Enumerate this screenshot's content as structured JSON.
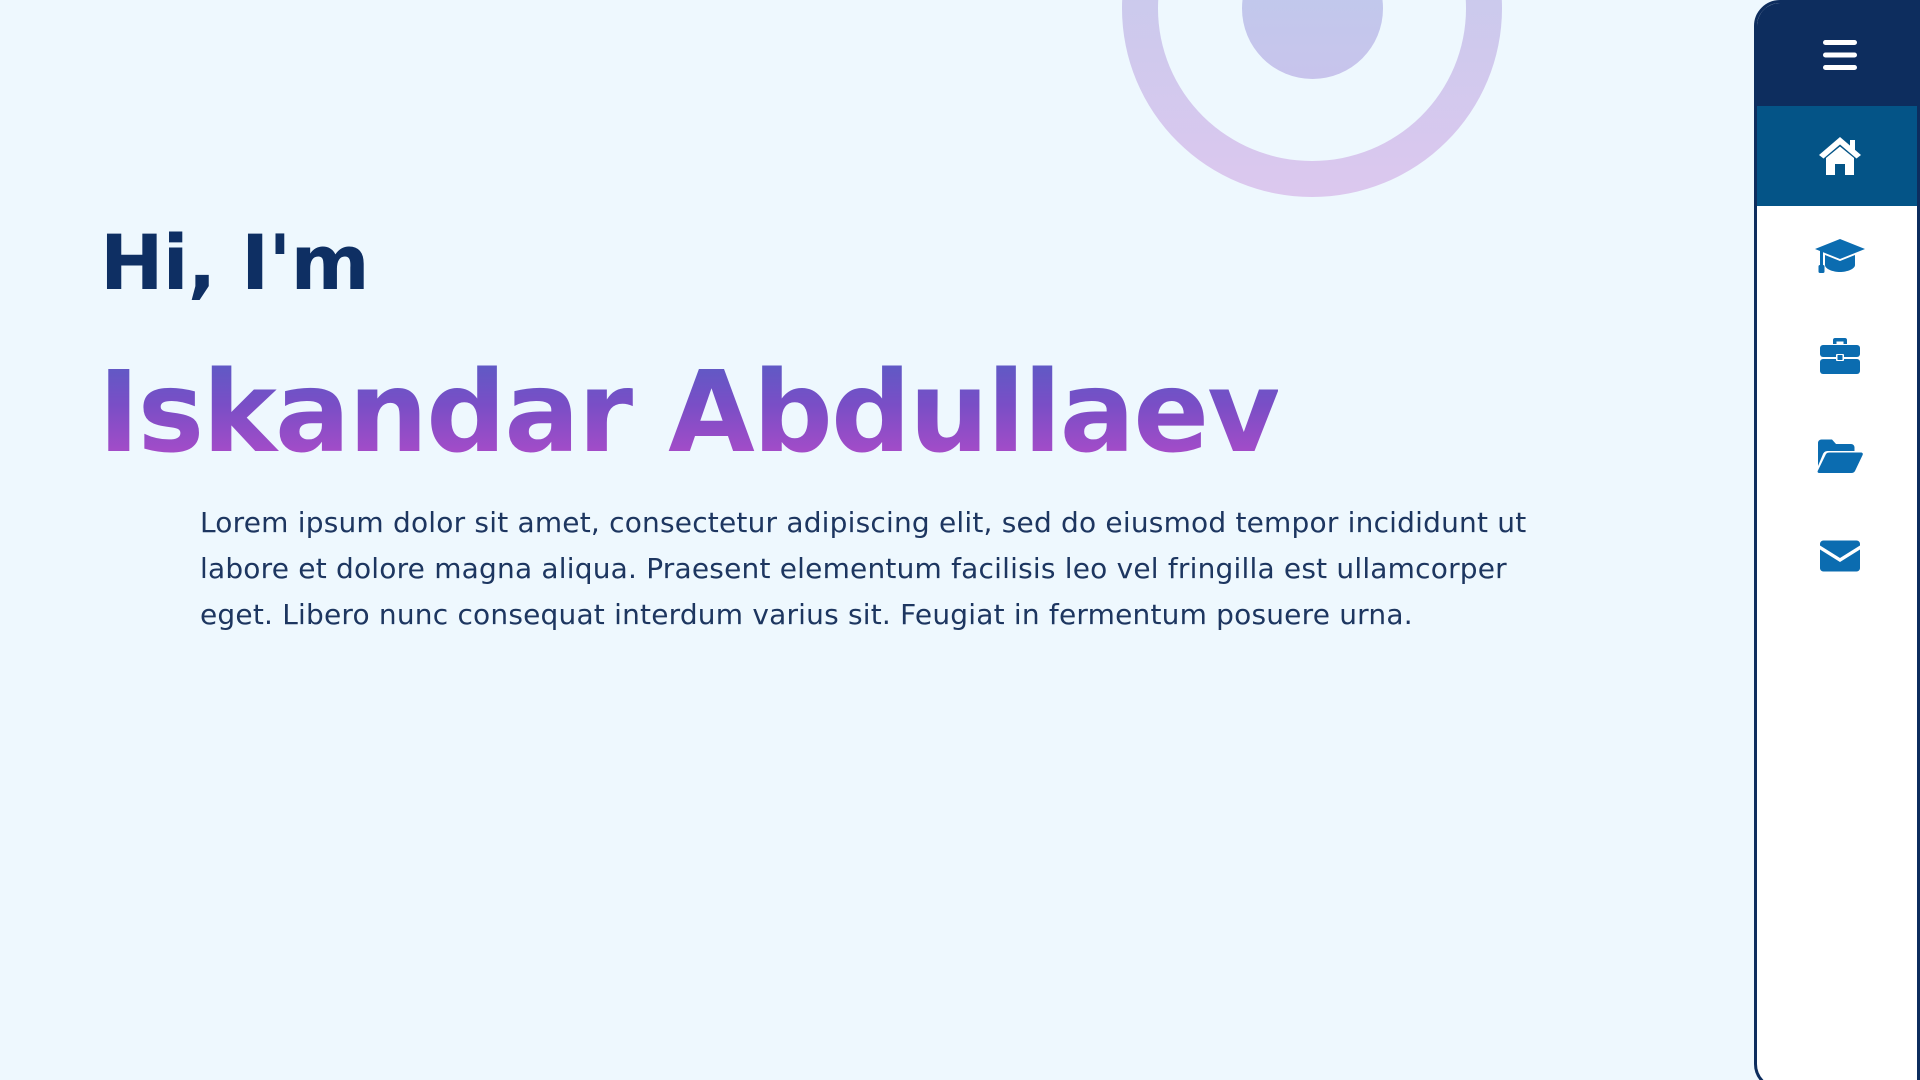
{
  "hero": {
    "greeting": "Hi, I'm",
    "name": "Iskandar Abdullaev",
    "intro": "Lorem ipsum dolor sit amet, consectetur adipiscing elit, sed do eiusmod tempor incididunt ut labore et dolore magna aliqua. Praesent elementum facilisis leo vel fringilla est ullamcorper eget. Libero nunc consequat interdum varius sit. Feugiat in fermentum posuere urna."
  },
  "nav": {
    "items": [
      {
        "icon": "menu-icon",
        "active": false
      },
      {
        "icon": "home-icon",
        "active": true
      },
      {
        "icon": "graduation-cap-icon",
        "active": false
      },
      {
        "icon": "briefcase-icon",
        "active": false
      },
      {
        "icon": "folder-open-icon",
        "active": false
      },
      {
        "icon": "envelope-icon",
        "active": false
      }
    ]
  },
  "colors": {
    "background": "#eef8fe",
    "navy": "#0d2d5e",
    "active_nav": "#045487",
    "icon_blue": "#0b6cb0",
    "name_gradient_top": "#4e61c4",
    "name_gradient_bottom": "#a84cc8"
  }
}
